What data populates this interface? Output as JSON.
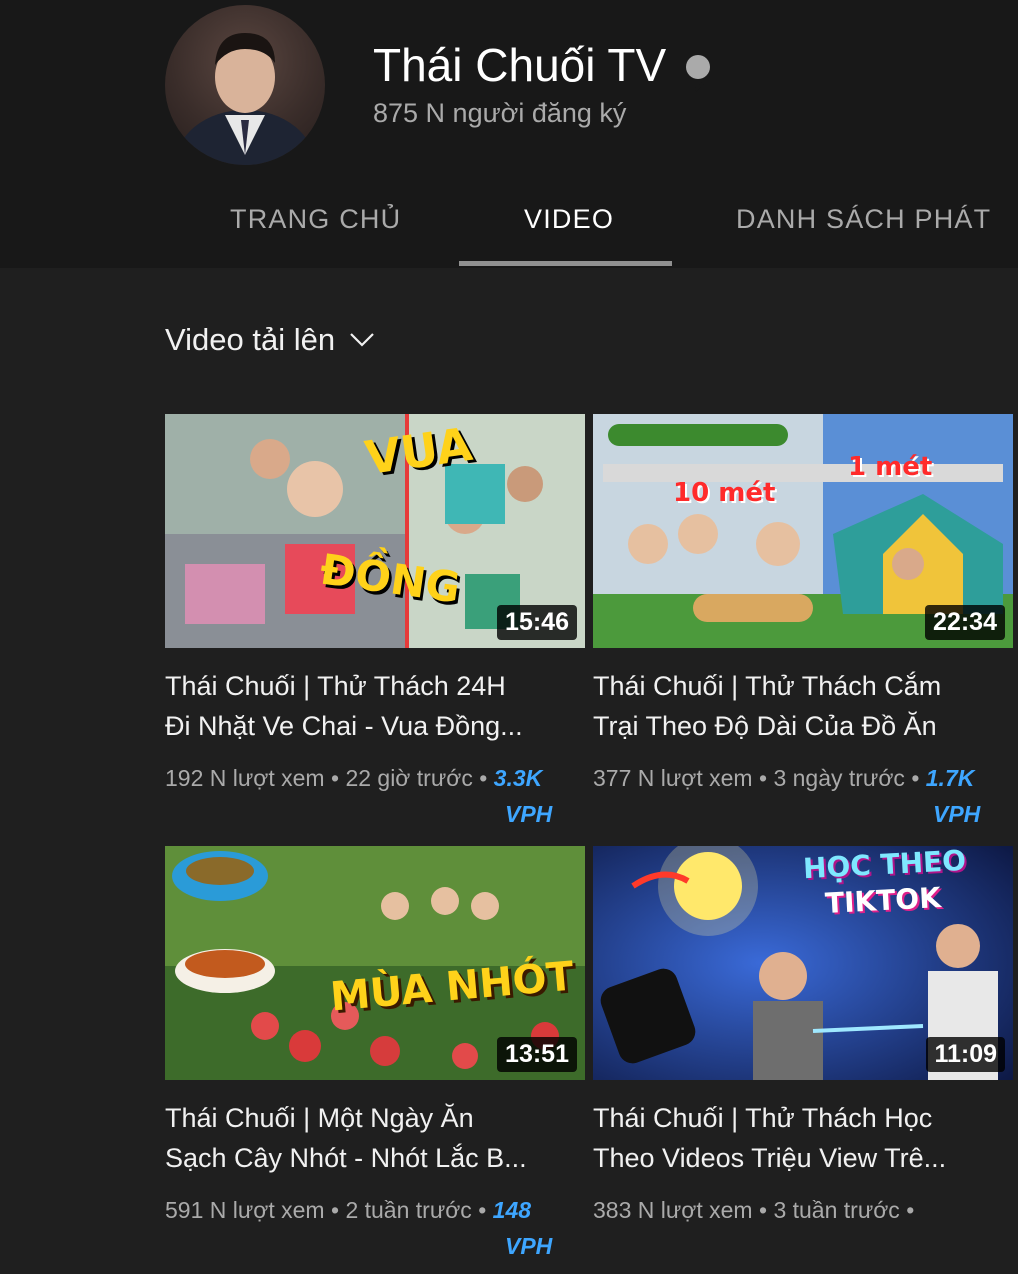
{
  "channel": {
    "name": "Thái Chuối TV",
    "subscribers": "875 N người đăng ký"
  },
  "tabs": [
    {
      "label": "TRANG CHỦ",
      "active": false
    },
    {
      "label": "VIDEO",
      "active": true
    },
    {
      "label": "DANH SÁCH PHÁT",
      "active": false
    }
  ],
  "filter": {
    "label": "Video tải lên"
  },
  "videos": [
    {
      "title_line1": "Thái Chuối | Thử Thách 24H",
      "title_line2": "Đi Nhặt Ve Chai - Vua Đồng...",
      "views": "192 N lượt xem",
      "age": "22 giờ trước",
      "vph_value": "3.3K",
      "vph_unit": "VPH",
      "duration": "15:46",
      "thumb_text": [
        "VUA",
        "ĐỒNG"
      ]
    },
    {
      "title_line1": "Thái Chuối | Thử Thách Cắm",
      "title_line2": "Trại Theo Độ Dài Của Đồ Ăn",
      "views": "377 N lượt xem",
      "age": "3 ngày trước",
      "vph_value": "1.7K",
      "vph_unit": "VPH",
      "duration": "22:34",
      "thumb_text": [
        "10 mét",
        "1 mét"
      ]
    },
    {
      "title_line1": "Thái Chuối | Một Ngày Ăn",
      "title_line2": "Sạch Cây Nhót - Nhót Lắc B...",
      "views": "591 N lượt xem",
      "age": "2 tuần trước",
      "vph_value": "148",
      "vph_unit": "VPH",
      "duration": "13:51",
      "thumb_text": [
        "MÙA NHÓT"
      ]
    },
    {
      "title_line1": "Thái Chuối | Thử Thách Học",
      "title_line2": "Theo Videos Triệu View Trê...",
      "views": "383 N lượt xem",
      "age": "3 tuần trước",
      "vph_value": "",
      "vph_unit": "",
      "duration": "11:09",
      "thumb_text": [
        "HỌC THEO",
        "TIKTOK"
      ]
    }
  ],
  "colors": {
    "background": "#1f1f1f",
    "header": "#181818",
    "muted_text": "#aaaaaa",
    "vph": "#3ea6ff"
  }
}
